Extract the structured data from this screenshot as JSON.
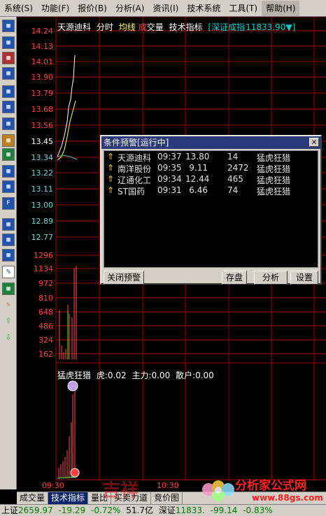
{
  "menu": [
    "系统(S)",
    "功能(F)",
    "报价(B)",
    "分析(A)",
    "资讯(I)",
    "技术系统",
    "工具(T)",
    "帮助(H)"
  ],
  "header": {
    "stock_name": "天源迪科",
    "mode": "分时",
    "avg_line": "均线",
    "cheng": "成",
    "volume": "交量",
    "indicator": "技术指标",
    "index_label": "[深证成指",
    "index_value": "11833.90▼]"
  },
  "price_axis": [
    "14.24",
    "14.13",
    "14.01",
    "13.90",
    "13.79",
    "13.68",
    "13.56",
    "13.45",
    "13.34",
    "13.22",
    "13.11",
    "13.00",
    "12.89",
    "12.77"
  ],
  "volume_axis": [
    "1296",
    "1134",
    "972",
    "810",
    "648",
    "486",
    "324",
    "162"
  ],
  "time_axis": [
    "09:30",
    "10:30"
  ],
  "sub_indicator": {
    "name": "猛虎狂猎",
    "hu": "虎:0.02",
    "zhuli": "主力:0.00",
    "sanhu": "散户:0.00"
  },
  "dialog": {
    "title": "条件预警[运行中]",
    "close": "✕",
    "rows": [
      {
        "name": "天源迪科",
        "time": "09:37",
        "price": "13.80",
        "vol": "14",
        "signal": "猛虎狂猎"
      },
      {
        "name": "南洋股份",
        "time": "09:35",
        "price": "9.11",
        "vol": "2472",
        "signal": "猛虎狂猎"
      },
      {
        "name": "辽通化工",
        "time": "09:34",
        "price": "12.44",
        "vol": "465",
        "signal": "猛虎狂猎"
      },
      {
        "name": "ST国药",
        "time": "09:31",
        "price": "6.46",
        "vol": "74",
        "signal": "猛虎狂猎"
      }
    ],
    "buttons": {
      "close_alert": "关闭预警",
      "save": "存盘",
      "analyze": "分析",
      "settings": "设置"
    }
  },
  "tabs": [
    "成交量",
    "技术指标",
    "量比",
    "买卖力道",
    "竞价图"
  ],
  "status": {
    "sh_label": "上证",
    "sh_value": "2659.97",
    "sh_change": "-19.29",
    "sh_pct": "-0.72%",
    "sh_amount": "51.7亿",
    "sz_label": "深证",
    "sz_value": "11833.",
    "sz_change": "-99.14",
    "sz_pct": "-0.83%"
  },
  "watermark": {
    "logo_text": "吉祥",
    "site_name": "分析家公式网",
    "url": "www.88gs.com"
  },
  "colors": {
    "grid_red": "#a00000",
    "axis_red": "#ff4040",
    "axis_cyan": "#6fd6d6",
    "price_white": "#ffffff",
    "avg_yellow": "#ffff60",
    "volume_red": "#ff5050",
    "rise": "#ff4040",
    "fall": "#40ff40",
    "index_cyan": "#00d0d0"
  }
}
